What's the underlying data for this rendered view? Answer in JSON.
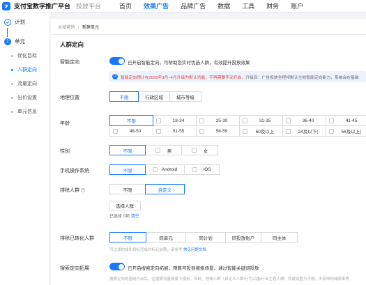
{
  "header": {
    "brand": "支付宝数字推广平台",
    "sub": "投放平台",
    "nav": [
      "首页",
      "效果广告",
      "品牌广告",
      "数据",
      "工具",
      "财务",
      "账户"
    ],
    "active_nav": "效果广告"
  },
  "steps": {
    "step1": {
      "label": "计划"
    },
    "step2": {
      "num": "2",
      "label": "单元"
    },
    "items": [
      {
        "label": "优化目标"
      },
      {
        "label": "人群定向"
      },
      {
        "label": "流量定向"
      },
      {
        "label": "出价设置"
      },
      {
        "label": "单元信息"
      }
    ],
    "active_item": "人群定向"
  },
  "breadcrumb": {
    "parent": "全域营销",
    "sep": "/",
    "current": "新建单元"
  },
  "section_title": "人群定向",
  "smart": {
    "label": "智能定向",
    "toggle_text": "已开启智能定向，可帮助您实时优选人群，有效提升投放效果",
    "notice_red": "智能定向预计在2025年3月~4月升级为默认功能，不再需要手动开启，",
    "notice_gray": "升级后：广告投放全程将默认生效智能定向能力，系统会在基础"
  },
  "location": {
    "label": "地理位置",
    "options": [
      "不限",
      "行政区域",
      "城市等级"
    ],
    "active": "不限"
  },
  "age": {
    "label": "年龄",
    "options": [
      "不限",
      "18-24",
      "25-30",
      "31-35",
      "36-40",
      "41-45",
      "46-50",
      "51-55",
      "56-59",
      "60及以上",
      "24及以下(",
      "56及以上("
    ],
    "active": "不限"
  },
  "gender": {
    "label": "性别",
    "options": [
      "不限",
      "男",
      "女"
    ],
    "active": "不限"
  },
  "os": {
    "label": "手机操作系统",
    "options": [
      "不限",
      "Android",
      "IOS"
    ],
    "active": "不限"
  },
  "exclude_crowd": {
    "label": "排除人群",
    "options": [
      "不限",
      "自定义"
    ],
    "active": "自定义",
    "select_button": "选择人群",
    "selected_text": "已选择 0项",
    "clear": "清空"
  },
  "exclude_converted": {
    "label": "排除已转化人群",
    "options": [
      "不限",
      "同单元",
      "同计划",
      "同投放账户",
      "同主体"
    ],
    "active": "不限",
    "hint": "可过滤的成化目标完成时标记前期，请参考",
    "hint_link": "常见问题文档"
  },
  "search_expand": {
    "label": "搜索定向拓展",
    "toggle_text": "已开启搜索定向拓展，预算可投到搜索场景，通过智能关键词投放",
    "hint": "搜索定向将围绕开启后，在搜索流量场景下使用、年龄、地域人群（自定义人群/行为兴趣/行业主题人群）将被设置为不限，不影响地域频率等"
  }
}
